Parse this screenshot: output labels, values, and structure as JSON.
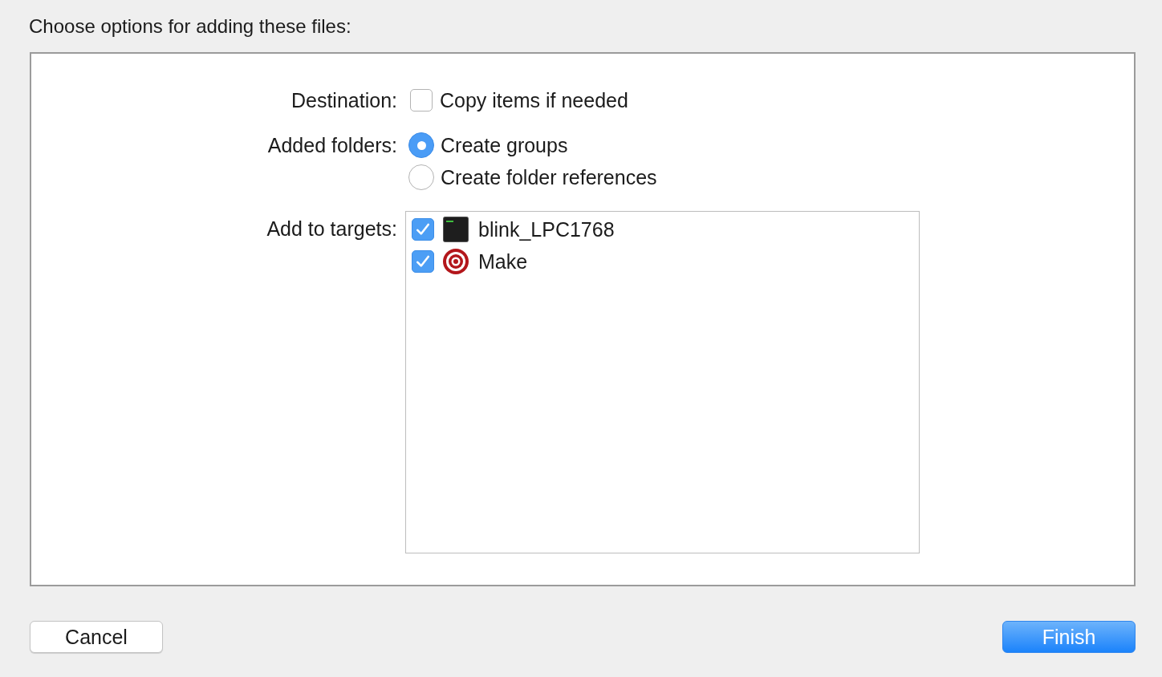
{
  "title": "Choose options for adding these files:",
  "destination": {
    "label": "Destination:",
    "option": {
      "label": "Copy items if needed",
      "checked": false
    }
  },
  "added_folders": {
    "label": "Added folders:",
    "options": [
      {
        "label": "Create groups",
        "selected": true
      },
      {
        "label": "Create folder references",
        "selected": false
      }
    ]
  },
  "targets": {
    "label": "Add to targets:",
    "items": [
      {
        "name": "blink_LPC1768",
        "checked": true,
        "kind": "executable"
      },
      {
        "name": "Make",
        "checked": true,
        "kind": "target"
      }
    ]
  },
  "buttons": [
    {
      "label": "Cancel",
      "kind": "default"
    },
    {
      "label": "Finish",
      "kind": "primary"
    }
  ]
}
